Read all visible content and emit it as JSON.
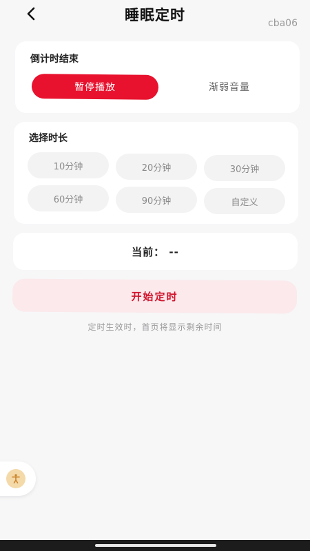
{
  "header": {
    "title": "睡眠定时",
    "version": "cba06"
  },
  "end_section": {
    "title": "倒计时结束",
    "options": [
      {
        "label": "暂停播放",
        "selected": true
      },
      {
        "label": "渐弱音量",
        "selected": false
      }
    ]
  },
  "duration_section": {
    "title": "选择时长",
    "options": [
      {
        "label": "10分钟"
      },
      {
        "label": "20分钟"
      },
      {
        "label": "30分钟"
      },
      {
        "label": "60分钟"
      },
      {
        "label": "90分钟"
      },
      {
        "label": "自定义"
      }
    ]
  },
  "current": {
    "text": "当前： --"
  },
  "start_button": {
    "label": "开始定时"
  },
  "hint": {
    "text": "定时生效时，首页将显示剩余时间"
  },
  "colors": {
    "accent": "#e8122e",
    "start_bg": "#fbe9ec",
    "start_text": "#d0142c",
    "chip_bg": "#f3f3f4"
  },
  "icons": {
    "back": "chevron-left-icon",
    "accessibility": "accessibility-icon"
  }
}
